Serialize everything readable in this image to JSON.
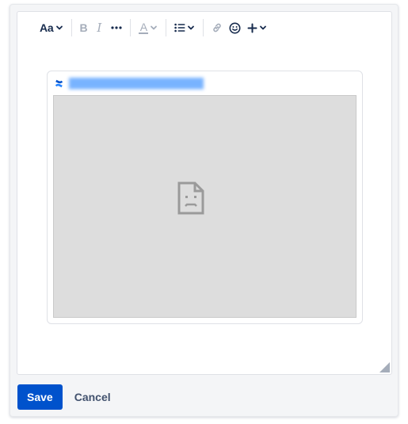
{
  "toolbar": {
    "text_style_label": "Aa",
    "bold_label": "B",
    "italic_label": "I",
    "more_formatting_label": "···",
    "text_color_label": "A",
    "icons": [
      "chevron-down-icon",
      "bulleted-list-icon",
      "link-icon",
      "emoji-icon",
      "plus-icon"
    ]
  },
  "embed": {
    "icon": "confluence-logo-icon",
    "frame_icon": "broken-page-icon"
  },
  "footer": {
    "save_label": "Save",
    "cancel_label": "Cancel"
  },
  "colors": {
    "primary": "#0052cc",
    "toolbar_text": "#172b4d",
    "toolbar_disabled": "#a5adba",
    "link_blue": "#4c9aff",
    "frame_gray": "#dddddd"
  }
}
